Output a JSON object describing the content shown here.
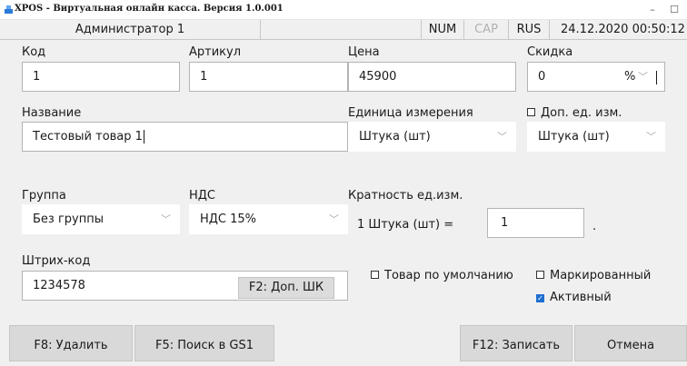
{
  "window": {
    "title": "XPOS - Виртуальная онлайн касса. Версия 1.0.001",
    "minimize_glyph": "–",
    "maximize_glyph": "☐",
    "close_glyph": "×"
  },
  "status_bar": {
    "user": "Администратор 1",
    "num": "NUM",
    "cap": "CAP",
    "lang": "RUS",
    "datetime": "24.12.2020 00:50:12"
  },
  "form": {
    "code": {
      "label": "Код",
      "value": "1"
    },
    "article": {
      "label": "Артикул",
      "value": "1"
    },
    "price": {
      "label": "Цена",
      "value": "45900"
    },
    "discount": {
      "label": "Скидка",
      "value": "0",
      "unit": "%"
    },
    "name": {
      "label": "Название",
      "value": "Тестовый товар 1"
    },
    "unit": {
      "label": "Единица измерения",
      "value": "Штука  (шт)"
    },
    "extra_unit": {
      "label": "Доп. ед. изм.",
      "value": "Штука  (шт)",
      "checked": false
    },
    "group": {
      "label": "Группа",
      "value": "Без группы"
    },
    "vat": {
      "label": "НДС",
      "value": "НДС 15%"
    },
    "multiplicity": {
      "label": "Кратность ед.изм.",
      "prefix": "1 Штука  (шт) =",
      "value": "1",
      "suffix": "."
    },
    "barcode": {
      "label": "Штрих-код",
      "value": "1234578",
      "extra_button": "F2: Доп. ШК"
    },
    "default_product": {
      "label": "Товар по умолчанию",
      "checked": false
    },
    "marked": {
      "label": "Маркированный",
      "checked": false
    },
    "active": {
      "label": "Активный",
      "checked": true
    }
  },
  "buttons": {
    "delete": "F8: Удалить",
    "search_gs1": "F5: Поиск в GS1",
    "save": "F12: Записать",
    "cancel": "Отмена"
  },
  "colors": {
    "accent": "#1f6fd1",
    "background": "#f0f0f0",
    "button": "#d9d9d9"
  }
}
